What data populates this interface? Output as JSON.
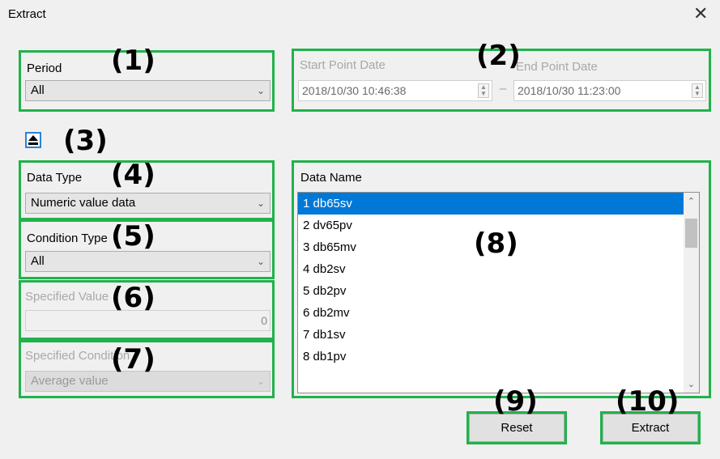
{
  "window": {
    "title": "Extract",
    "close_glyph": "✕"
  },
  "period": {
    "label": "Period",
    "value": "All"
  },
  "range": {
    "start_label": "Start Point Date",
    "start_value": "2018/10/30 10:46:38",
    "separator": "–",
    "end_label": "End Point Date",
    "end_value": "2018/10/30 11:23:00"
  },
  "data_type": {
    "label": "Data Type",
    "value": "Numeric value data"
  },
  "condition_type": {
    "label": "Condition Type",
    "value": "All"
  },
  "specified_value": {
    "label": "Specified Value",
    "value": "0"
  },
  "specified_condition": {
    "label": "Specified Condition",
    "value": "Average value"
  },
  "data_name": {
    "label": "Data Name",
    "items": [
      "1 db65sv",
      "2 dv65pv",
      "3 db65mv",
      "4 db2sv",
      "5 db2pv",
      "6 db2mv",
      "7 db1sv",
      "8 db1pv"
    ],
    "selected_index": 0
  },
  "buttons": {
    "reset": "Reset",
    "extract": "Extract"
  },
  "callouts": {
    "c1": "(1)",
    "c2": "(2)",
    "c3": "(3)",
    "c4": "(4)",
    "c5": "(5)",
    "c6": "(6)",
    "c7": "(7)",
    "c8": "(8)",
    "c9": "(9)",
    "c10": "(10)"
  },
  "colors": {
    "callout_border": "#21b24b",
    "selection": "#0078d7",
    "collapse_button_border": "#2a83d3"
  },
  "icons": {
    "close": "close-icon",
    "collapse": "eject-icon",
    "dropdown": "chevron-down-icon",
    "spinner": "spin-arrows-icon"
  }
}
